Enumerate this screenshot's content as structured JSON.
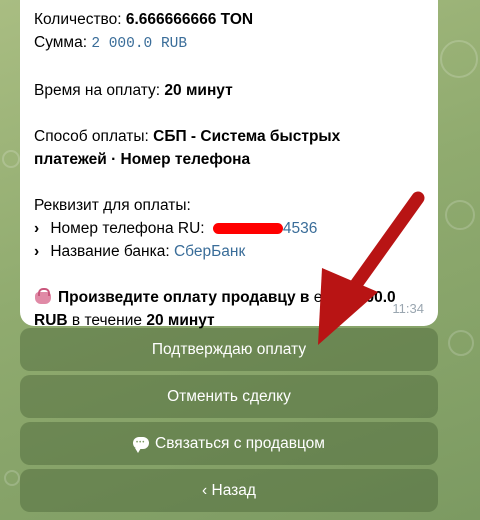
{
  "message": {
    "quantity_label": "Количество:",
    "quantity_value": "6.666666666 TON",
    "sum_label": "Сумма:",
    "sum_value": "2 000.0 RUB",
    "pay_time_label": "Время на оплату:",
    "pay_time_value": "20 минут",
    "method_label": "Способ оплаты:",
    "method_value": "СБП - Система быстрых платежей · Номер телефона",
    "requisite_heading": "Реквизит для оплаты:",
    "phone_label": "Номер телефона RU:",
    "phone_visible_suffix": "4536",
    "bank_label": "Название банка:",
    "bank_value": "СберБанк",
    "instruction_part1": "Произведите оплату продавцу в",
    "instruction_part2": "ере",
    "instruction_amount": "2 000.0 RUB",
    "instruction_part3": "в течение",
    "instruction_time": "20 минут",
    "time": "11:34"
  },
  "keyboard": {
    "confirm_label": "Подтверждаю оплату",
    "cancel_label": "Отменить сделку",
    "contact_label": "Связаться с продавцом",
    "back_label": "‹ Назад"
  },
  "icons": {
    "purse": "purse-icon",
    "contact": "speech-bubble-icon",
    "list_marker": "chevron-right-icon"
  },
  "colors": {
    "link": "#3a6d99",
    "annotation_arrow": "#b81414",
    "redaction": "#ff0000",
    "button_bg": "#5f7d4a"
  }
}
